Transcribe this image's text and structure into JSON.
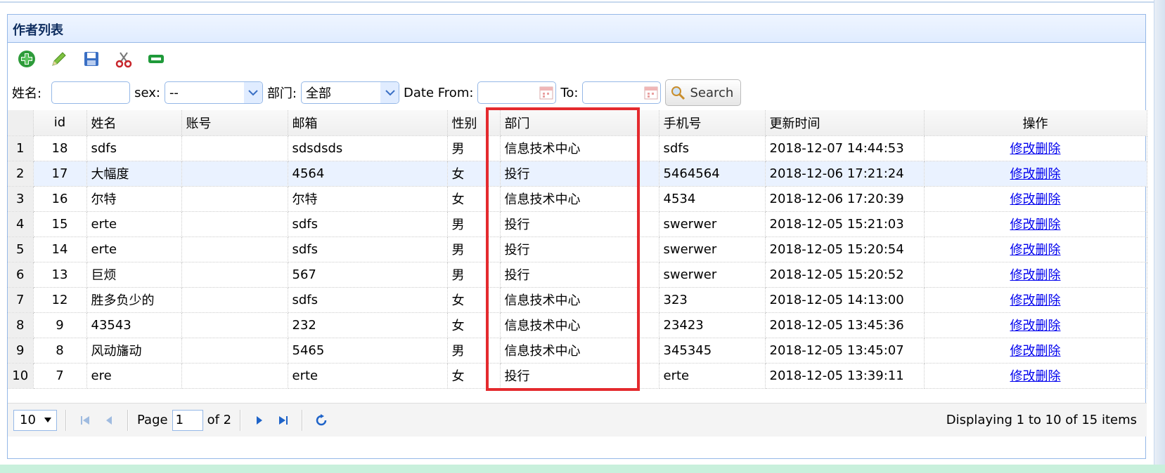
{
  "panel": {
    "title": "作者列表"
  },
  "toolbar": {
    "buttons": [
      {
        "name": "add-icon"
      },
      {
        "name": "edit-icon"
      },
      {
        "name": "save-icon"
      },
      {
        "name": "cut-icon"
      },
      {
        "name": "remove-icon"
      }
    ]
  },
  "filters": {
    "name_label": "姓名:",
    "name_value": "",
    "sex_label": "sex:",
    "sex_value": "--",
    "dept_label": "部门:",
    "dept_value": "全部",
    "date_from_label": "Date From:",
    "date_from_value": "",
    "to_label": "To:",
    "to_value": "",
    "search_label": "Search"
  },
  "table": {
    "headers": [
      "id",
      "姓名",
      "账号",
      "邮箱",
      "性别",
      "部门",
      "手机号",
      "更新时间",
      "操作"
    ],
    "rows": [
      {
        "rn": "1",
        "id": "18",
        "name": "sdfs",
        "account": "",
        "email": "sdsdsds",
        "sex": "男",
        "dept": "信息技术中心",
        "phone": "sdfs",
        "updated": "2018-12-07 14:44:53",
        "op": "修改删除"
      },
      {
        "rn": "2",
        "id": "17",
        "name": "大幅度",
        "account": "",
        "email": "4564",
        "sex": "女",
        "dept": "投行",
        "phone": "5464564",
        "updated": "2018-12-06 17:21:24",
        "op": "修改删除"
      },
      {
        "rn": "3",
        "id": "16",
        "name": "尔特",
        "account": "",
        "email": "尔特",
        "sex": "女",
        "dept": "信息技术中心",
        "phone": "4534",
        "updated": "2018-12-06 17:20:39",
        "op": "修改删除"
      },
      {
        "rn": "4",
        "id": "15",
        "name": "erte",
        "account": "",
        "email": "sdfs",
        "sex": "男",
        "dept": "投行",
        "phone": "swerwer",
        "updated": "2018-12-05 15:21:03",
        "op": "修改删除"
      },
      {
        "rn": "5",
        "id": "14",
        "name": "erte",
        "account": "",
        "email": "sdfs",
        "sex": "男",
        "dept": "投行",
        "phone": "swerwer",
        "updated": "2018-12-05 15:20:54",
        "op": "修改删除"
      },
      {
        "rn": "6",
        "id": "13",
        "name": "巨烦",
        "account": "",
        "email": "567",
        "sex": "男",
        "dept": "投行",
        "phone": "swerwer",
        "updated": "2018-12-05 15:20:52",
        "op": "修改删除"
      },
      {
        "rn": "7",
        "id": "12",
        "name": "胜多负少的",
        "account": "",
        "email": "sdfs",
        "sex": "女",
        "dept": "信息技术中心",
        "phone": "323",
        "updated": "2018-12-05 14:13:00",
        "op": "修改删除"
      },
      {
        "rn": "8",
        "id": "9",
        "name": "43543",
        "account": "",
        "email": "232",
        "sex": "女",
        "dept": "信息技术中心",
        "phone": "23423",
        "updated": "2018-12-05 13:45:36",
        "op": "修改删除"
      },
      {
        "rn": "9",
        "id": "8",
        "name": "风动旛动",
        "account": "",
        "email": "5465",
        "sex": "男",
        "dept": "信息技术中心",
        "phone": "345345",
        "updated": "2018-12-05 13:45:07",
        "op": "修改删除"
      },
      {
        "rn": "10",
        "id": "7",
        "name": "ere",
        "account": "",
        "email": "erte",
        "sex": "女",
        "dept": "投行",
        "phone": "erte",
        "updated": "2018-12-05 13:39:11",
        "op": "修改删除"
      }
    ]
  },
  "pager": {
    "page_size": "10",
    "page_label": "Page",
    "page_value": "1",
    "of_label": "of 2",
    "info": "Displaying 1 to 10 of 15 items"
  },
  "colors": {
    "highlight": "#e42a2e",
    "panel_border": "#95b8e7",
    "link": "#0000ee"
  }
}
